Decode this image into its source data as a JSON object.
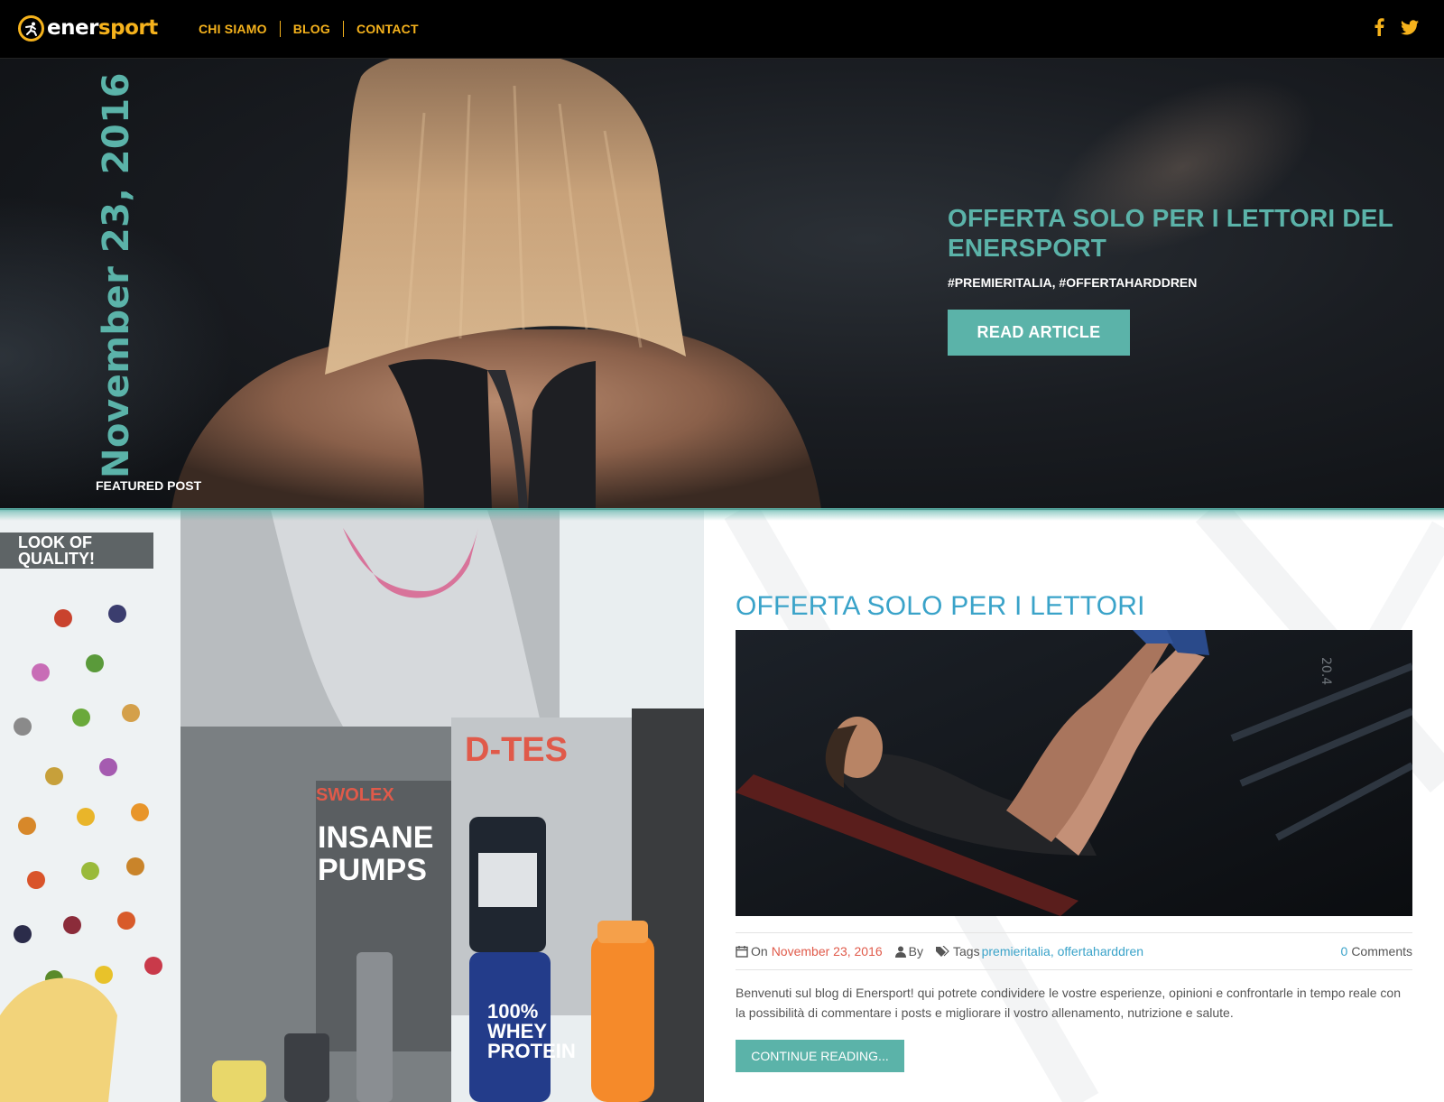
{
  "brand": {
    "logo_white": "ener",
    "logo_yellow": "sport",
    "accent": "#f5b21c",
    "teal": "#5bb3a9",
    "link_blue": "#3aa3c9",
    "date_red": "#e05a4a"
  },
  "nav": {
    "items": [
      {
        "label": "CHI SIAMO"
      },
      {
        "label": "BLOG"
      },
      {
        "label": "CONTACT"
      }
    ]
  },
  "social": {
    "icons": [
      "facebook-icon",
      "twitter-icon"
    ]
  },
  "hero": {
    "date": "November 23, 2016",
    "featured_label": "FEATURED POST",
    "title": "OFFERTA SOLO PER I LETTORI DEL ENERSPORT",
    "tags": "#PREMIERITALIA, #OFFERTAHARDDREN",
    "button_label": "READ ARTICLE"
  },
  "post": {
    "title": "OFFERTA SOLO PER I LETTORI",
    "meta": {
      "on_label": "On",
      "date": "November 23, 2016",
      "by_label": "By",
      "tags_label": "Tags",
      "tags": "premieritalia, offertaharddren",
      "comment_count": "0",
      "comments_label": "Comments"
    },
    "excerpt": "Benvenuti sul blog di Enersport! qui potrete condividere le vostre esperienze, opinioni e confrontarle in tempo reale con la possibilità di commentare i posts e migliorare il vostro allenamento, nutrizione e salute.",
    "button_label": "CONTINUE READING..."
  },
  "collage": {
    "poster_text": "LOOK OF QUALITY!",
    "poster_label_1": "D-TES",
    "poster_label_2": "INSANE PUMPS",
    "product_label": "100% WHEY PROTEIN",
    "brand_label": "SWOLEX"
  }
}
